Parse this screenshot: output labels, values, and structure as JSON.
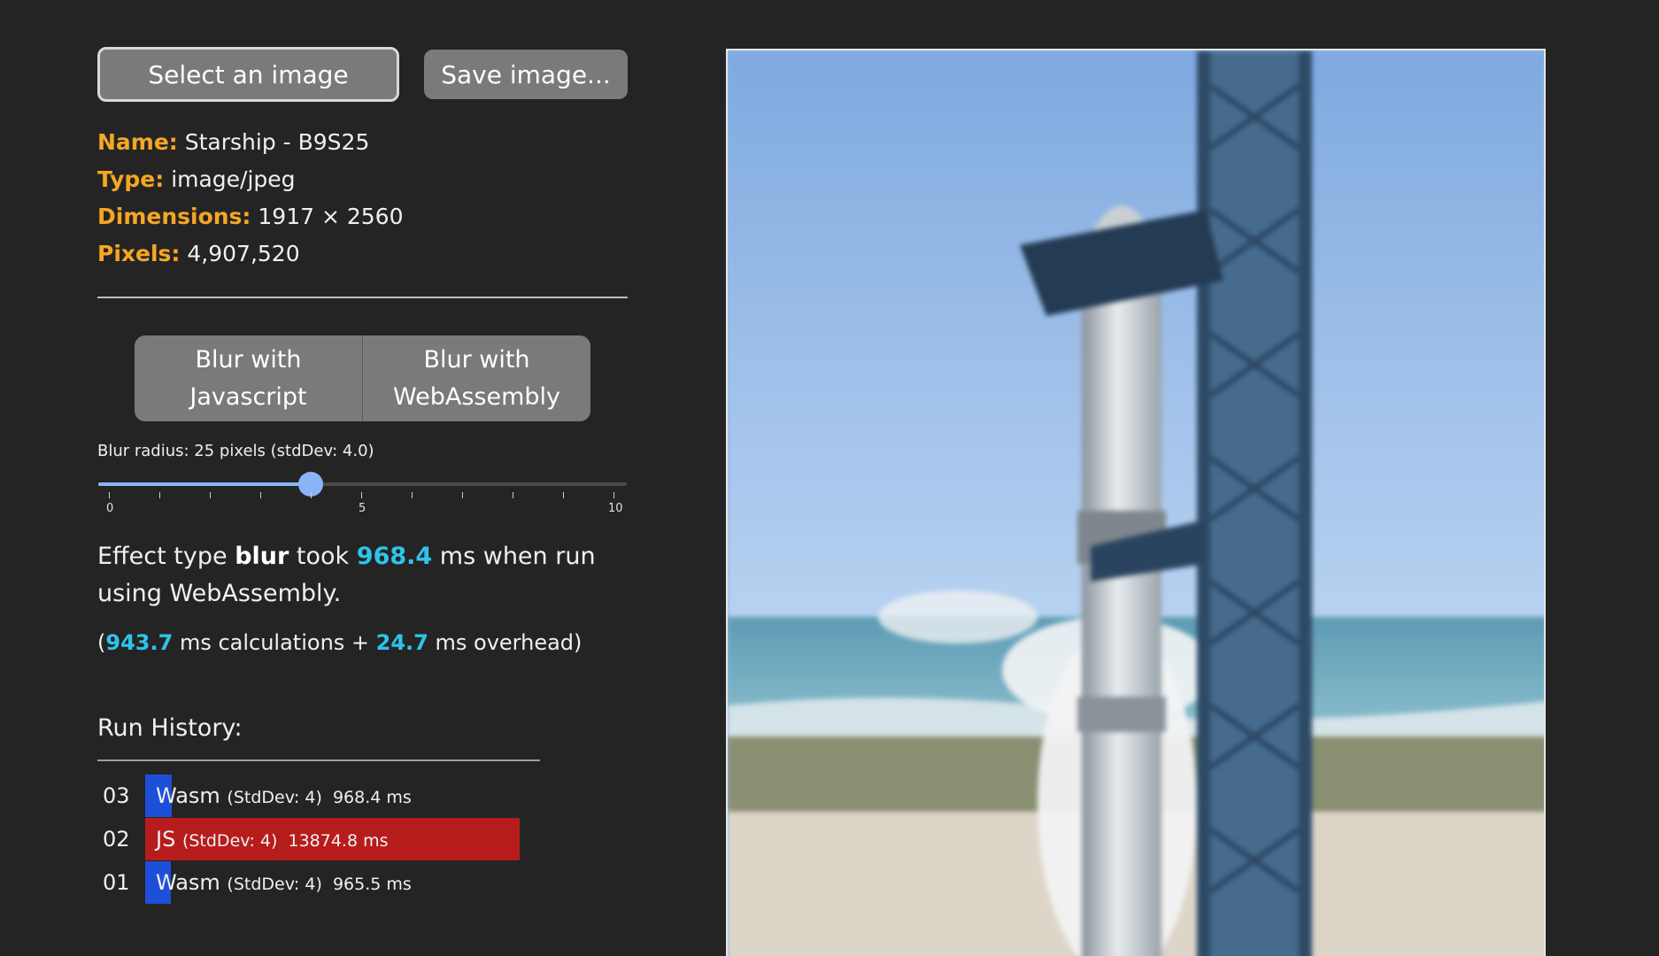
{
  "toolbar": {
    "select_label": "Select an image",
    "save_label": "Save image..."
  },
  "image_info": {
    "name_label": "Name:",
    "name_value": "Starship - B9S25",
    "type_label": "Type:",
    "type_value": "image/jpeg",
    "dimensions_label": "Dimensions:",
    "dimensions_value": "1917 × 2560",
    "pixels_label": "Pixels:",
    "pixels_value": "4,907,520"
  },
  "blur_buttons": {
    "js_line1": "Blur with",
    "js_line2": "Javascript",
    "wasm_line1": "Blur with",
    "wasm_line2": "WebAssembly"
  },
  "slider": {
    "label": "Blur radius: 25 pixels (stdDev: 4.0)",
    "min_label": "0",
    "mid_label": "5",
    "max_label": "10",
    "value": 4,
    "min": 0,
    "max": 10,
    "accent_color": "#8ab4f8"
  },
  "result": {
    "prefix": "Effect type",
    "effect": "blur",
    "took": "took",
    "time_value": "968.4",
    "suffix": "ms when run using WebAssembly.",
    "calc_open": "(",
    "calc_value": "943.7",
    "calc_mid": "ms calculations +",
    "overhead_value": "24.7",
    "overhead_suffix": "ms overhead)",
    "accent_color": "#2ec4ea"
  },
  "history": {
    "title": "Run History:",
    "rows": [
      {
        "index": "03",
        "method": "Wasm",
        "stddev": "(StdDev: 4)",
        "time": "968.4 ms",
        "ms": 968.4,
        "color": "#1e4fd8"
      },
      {
        "index": "02",
        "method": "JS",
        "stddev": "(StdDev: 4)",
        "time": "13874.8 ms",
        "ms": 13874.8,
        "color": "#b71c1c"
      },
      {
        "index": "01",
        "method": "Wasm",
        "stddev": "(StdDev: 4)",
        "time": "965.5 ms",
        "ms": 965.5,
        "color": "#1e4fd8"
      }
    ]
  },
  "colors": {
    "background": "#242424",
    "label_orange": "#f5a623",
    "button_gray": "#7a7a7a"
  }
}
